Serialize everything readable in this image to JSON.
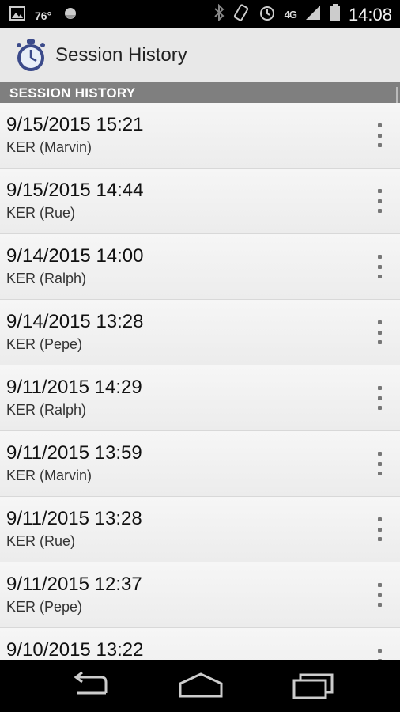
{
  "status_bar": {
    "temperature": "76°",
    "network": "4G",
    "time": "14:08"
  },
  "app_bar": {
    "title": "Session History"
  },
  "section": {
    "title": "SESSION HISTORY"
  },
  "sessions": [
    {
      "datetime": "9/15/2015 15:21",
      "detail": "KER (Marvin)"
    },
    {
      "datetime": "9/15/2015 14:44",
      "detail": "KER (Rue)"
    },
    {
      "datetime": "9/14/2015 14:00",
      "detail": "KER (Ralph)"
    },
    {
      "datetime": "9/14/2015 13:28",
      "detail": "KER (Pepe)"
    },
    {
      "datetime": "9/11/2015 14:29",
      "detail": "KER (Ralph)"
    },
    {
      "datetime": "9/11/2015 13:59",
      "detail": "KER (Marvin)"
    },
    {
      "datetime": "9/11/2015 13:28",
      "detail": "KER (Rue)"
    },
    {
      "datetime": "9/11/2015 12:37",
      "detail": "KER (Pepe)"
    },
    {
      "datetime": "9/10/2015 13:22",
      "detail": ""
    }
  ]
}
